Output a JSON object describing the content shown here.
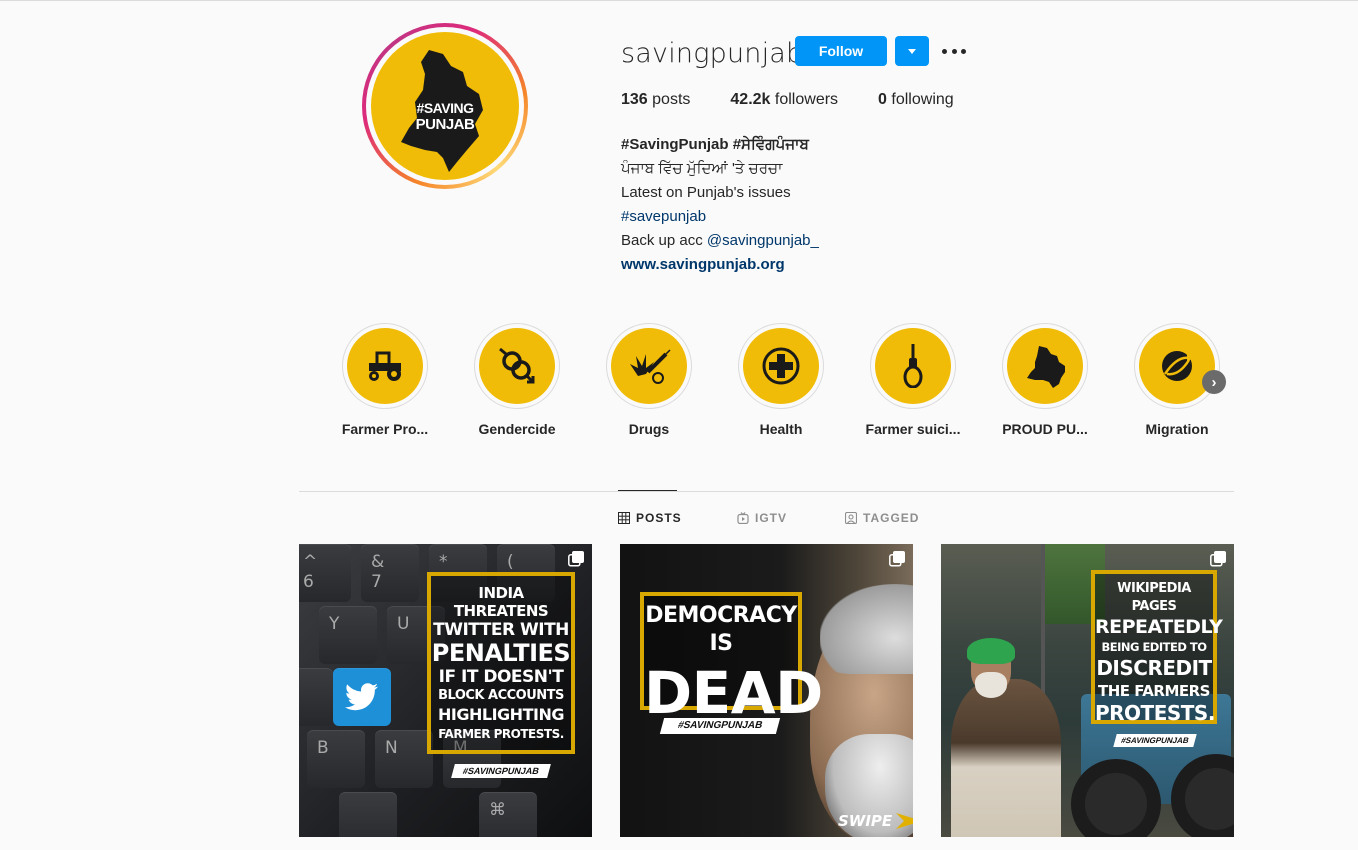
{
  "profile": {
    "username": "savingpunjab",
    "follow_label": "Follow",
    "avatar_text_line1": "#SAVING",
    "avatar_text_line2": "PUNJAB",
    "stats": {
      "posts_count": "136",
      "posts_label": "posts",
      "followers_count": "42.2k",
      "followers_label": "followers",
      "following_count": "0",
      "following_label": "following"
    },
    "bio": {
      "name_line": "#SavingPunjab #ਸੇਵਿੰਗਪੰਜਾਬ",
      "line2": "ਪੰਜਾਬ ਵਿੱਚ ਮੁੱਦਿਆਂ 'ਤੇ ਚਰਚਾ",
      "line3": "Latest on Punjab's issues",
      "hashtag": "#savepunjab",
      "backup_prefix": "Back up acc ",
      "backup_mention": "@savingpunjab_",
      "website": "www.savingpunjab.org"
    }
  },
  "highlights": [
    {
      "label": "Farmer Pro...",
      "icon": "tractor-icon"
    },
    {
      "label": "Gendercide",
      "icon": "gender-icon"
    },
    {
      "label": "Drugs",
      "icon": "drugs-icon"
    },
    {
      "label": "Health",
      "icon": "medical-cross-icon"
    },
    {
      "label": "Farmer suici...",
      "icon": "noose-icon"
    },
    {
      "label": "PROUD PU...",
      "icon": "punjab-map-icon"
    },
    {
      "label": "Migration",
      "icon": "migration-icon"
    }
  ],
  "tabs": [
    {
      "label": "POSTS",
      "icon": "grid-icon",
      "active": true
    },
    {
      "label": "IGTV",
      "icon": "igtv-icon",
      "active": false
    },
    {
      "label": "TAGGED",
      "icon": "tagged-icon",
      "active": false
    }
  ],
  "posts": [
    {
      "lines": [
        "INDIA THREATENS",
        "TWITTER WITH",
        "PENALTIES",
        "IF IT DOESN'T",
        "BLOCK ACCOUNTS",
        "HIGHLIGHTING",
        "FARMER PROTESTS."
      ],
      "tag": "#SAVINGPUNJAB",
      "keys": [
        "^\n6",
        "&\n7",
        "*",
        "(",
        "Y",
        "U",
        "B",
        "N",
        "M",
        "⌘"
      ]
    },
    {
      "lines": [
        "DEMOCRACY IS",
        "DEAD"
      ],
      "tag": "#SAVINGPUNJAB",
      "swipe": "SWIPE"
    },
    {
      "lines": [
        "WIKIPEDIA PAGES",
        "REPEATEDLY",
        "BEING EDITED TO",
        "DISCREDIT",
        "THE FARMERS",
        "PROTESTS."
      ],
      "tag": "#SAVINGPUNJAB"
    }
  ],
  "colors": {
    "accent": "#0095f6",
    "highlight_yellow": "#f1bc07",
    "link": "#00376b"
  }
}
